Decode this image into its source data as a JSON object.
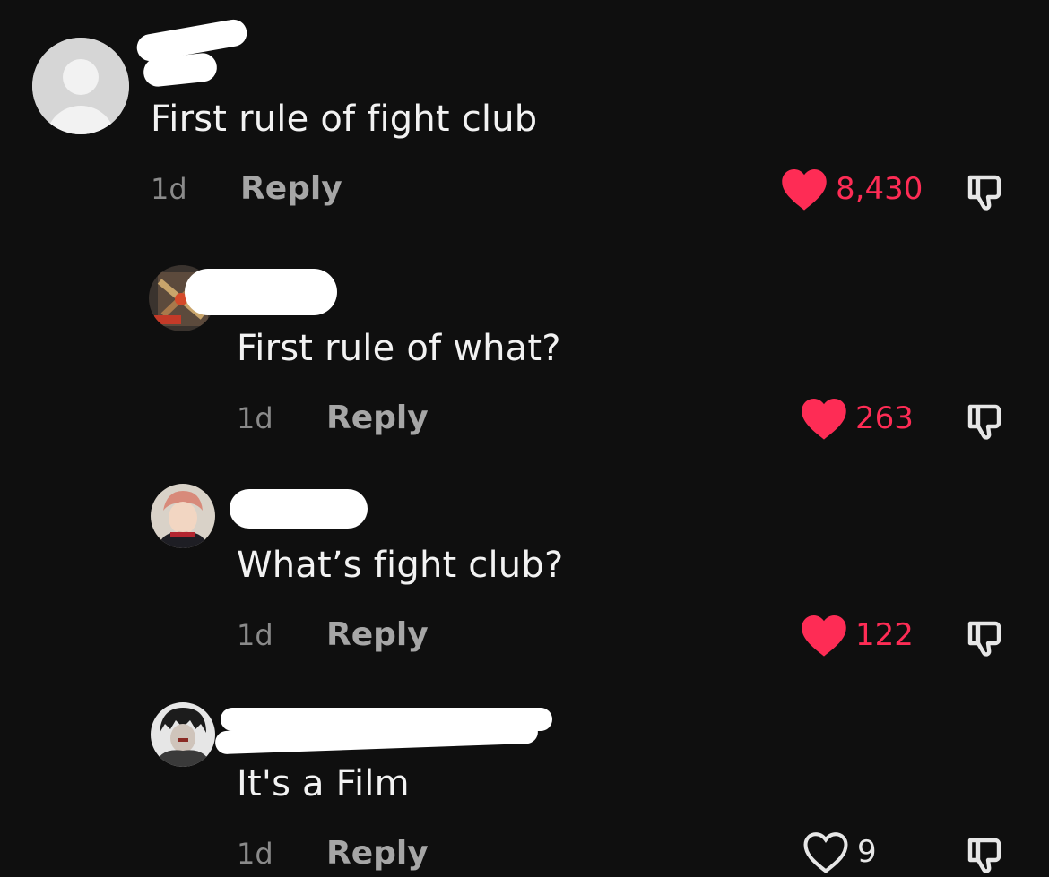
{
  "colors": {
    "background": "#0f0f0f",
    "like_active": "#fe2c55",
    "secondary_text": "#8a8a8a"
  },
  "comments": [
    {
      "text": "First rule of fight club",
      "time": "1d",
      "reply_label": "Reply",
      "likes": "8,430",
      "liked": true,
      "avatar_icon": "default-avatar-icon"
    },
    {
      "text": "First rule of what?",
      "time": "1d",
      "reply_label": "Reply",
      "likes": "263",
      "liked": true,
      "avatar_icon": "user-avatar-icon"
    },
    {
      "text": "What’s fight club?",
      "time": "1d",
      "reply_label": "Reply",
      "likes": "122",
      "liked": true,
      "avatar_icon": "anime-avatar-icon"
    },
    {
      "text": "It's a Film",
      "time": "1d",
      "reply_label": "Reply",
      "likes": "9",
      "liked": false,
      "avatar_icon": "anime-avatar-icon"
    }
  ]
}
